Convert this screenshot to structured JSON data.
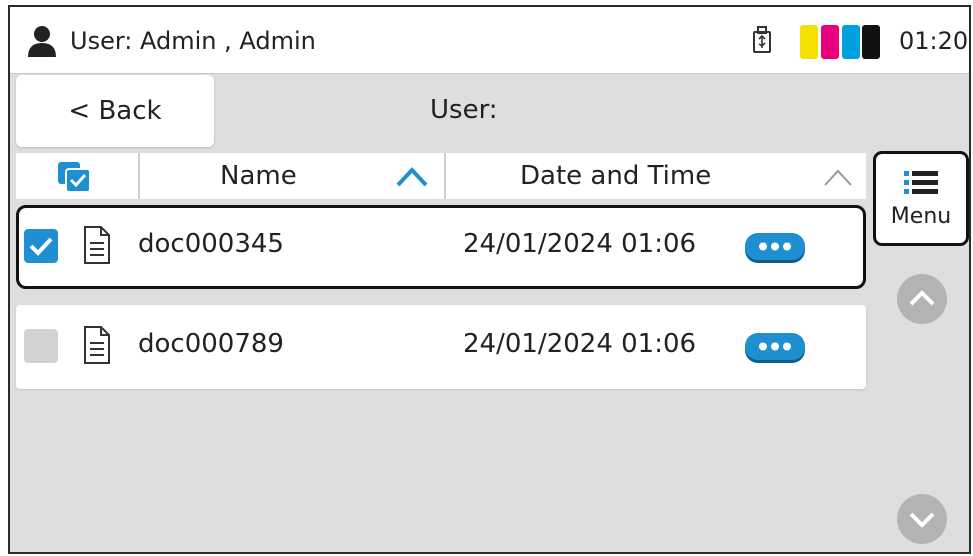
{
  "status_bar": {
    "user_label": "User: Admin , Admin",
    "time": "01:20",
    "icons": [
      "user-icon",
      "usb-icon",
      "toner-level-icon"
    ],
    "toner_colors": [
      "#f5e100",
      "#e8007f",
      "#00a0e0",
      "#111111"
    ]
  },
  "header": {
    "back_label": "< Back",
    "title": "User:"
  },
  "columns": {
    "select_icon": "select-all-icon",
    "name": "Name",
    "date": "Date and Time",
    "name_sort": "ascending",
    "date_sort": "inactive"
  },
  "menu": {
    "label": "Menu",
    "icon": "list-menu-icon"
  },
  "files": [
    {
      "name": "doc000345",
      "date": "24/01/2024 01:06",
      "checked": true,
      "selected": true
    },
    {
      "name": "doc000789",
      "date": "24/01/2024 01:06",
      "checked": false,
      "selected": false
    }
  ],
  "colors": {
    "accent": "#1e8fd0",
    "background": "#dedede",
    "panel": "#ffffff",
    "scroll_button": "#b3b3b3"
  }
}
